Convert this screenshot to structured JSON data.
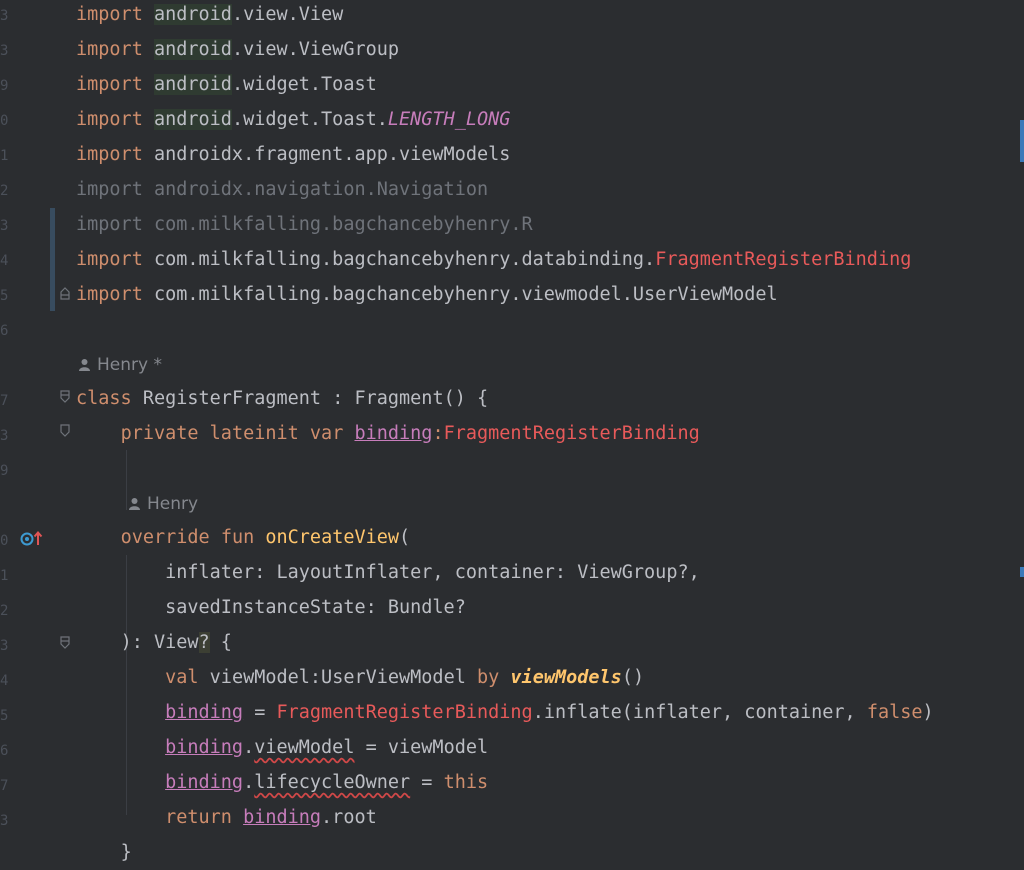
{
  "gutter": {
    "line_number_fragments": [
      "3",
      "3",
      "9",
      "0",
      "1",
      "2",
      "3",
      "4",
      "5",
      "6",
      "",
      "7",
      "3",
      "9",
      "",
      "0",
      "1",
      "2",
      "3",
      "4",
      "5",
      "6",
      "7",
      "3"
    ]
  },
  "code": {
    "imports": [
      {
        "kw": "import",
        "pkg_a": "android",
        "rest": ".view.View"
      },
      {
        "kw": "import",
        "pkg_a": "android",
        "rest": ".view.ViewGroup"
      },
      {
        "kw": "import",
        "pkg_a": "android",
        "rest": ".widget.Toast"
      },
      {
        "kw": "import",
        "pkg_a": "android",
        "rest": ".widget.Toast.",
        "extra": "LENGTH_LONG"
      },
      {
        "kw": "import",
        "text": "androidx.fragment.app.viewModels"
      },
      {
        "kw": "import",
        "text": "androidx.navigation.Navigation"
      },
      {
        "kw": "import",
        "text": "com.milkfalling.bagchancebyhenry.R"
      },
      {
        "kw": "import",
        "text": "com.milkfalling.bagchancebyhenry.databinding.",
        "extra": "FragmentRegisterBinding"
      },
      {
        "kw": "import",
        "text": "com.milkfalling.bagchancebyhenry.viewmodel.UserViewModel"
      }
    ],
    "author_hint_class": "Henry *",
    "author_hint_fun": "Henry",
    "class_kw": "class",
    "class_name": "RegisterFragment",
    "class_sep": " : ",
    "class_parent": "Fragment() {",
    "private_kw": "private",
    "lateinit_kw": "lateinit",
    "var_kw": "var",
    "binding": "binding",
    "binding_type": "FragmentRegisterBinding",
    "override_kw": "override",
    "fun_kw": "fun",
    "fun_name": "onCreateView",
    "param_line_1": "inflater: LayoutInflater, container: ViewGroup?,",
    "param_line_2": "savedInstanceState: Bundle?",
    "ret_open": "): View",
    "ret_q": "?",
    "ret_brace": " {",
    "val_kw": "val",
    "vm_decl": "viewModel:UserViewModel",
    "by_kw": "by",
    "vm_fun": "viewModels",
    "vm_paren": "()",
    "inflate_eq": " = ",
    "inflate_type": "FragmentRegisterBinding",
    "inflate_call": ".inflate(inflater, container, ",
    "false_kw": "false",
    "inflate_close": ")",
    "dot": ".",
    "prop_viewmodel": "viewModel",
    "assign_viewmodel": " = viewModel",
    "prop_lifecycle": "lifecycleOwner",
    "assign_this_eq": " = ",
    "this_kw": "this",
    "return_kw": "return",
    "root": ".root",
    "closing": "}"
  },
  "colors": {
    "background": "#2b2d30",
    "keyword": "#cf8e6d",
    "text": "#bcbec4",
    "property": "#c77dbb",
    "function": "#ffc66d",
    "type_error": "#e85a5a",
    "comment_dim": "#6f737a"
  }
}
